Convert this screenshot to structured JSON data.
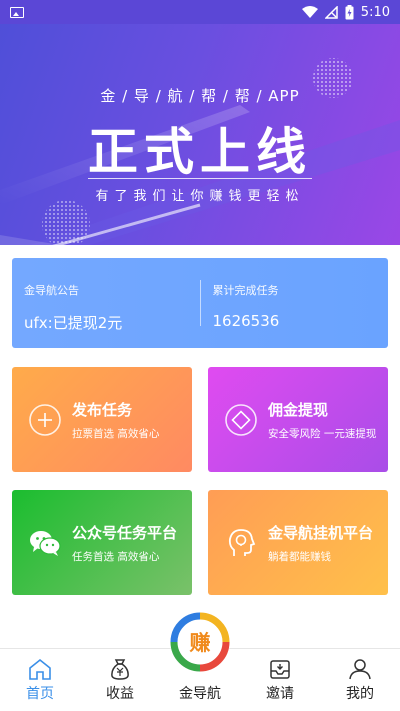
{
  "status_bar": {
    "time": "5:10",
    "icons": [
      "image-icon",
      "wifi-icon",
      "no-signal-icon",
      "battery-charging-icon"
    ]
  },
  "hero": {
    "tagline": "金 / 导 / 航 / 帮 / 帮 / APP",
    "title": "正式上线",
    "subtitle": "有了我们让你赚钱更轻松",
    "colors": {
      "start": "#4e4fd8",
      "end": "#9a47e6"
    }
  },
  "notice": {
    "left": {
      "label": "金导航公告",
      "value": "ufx:已提现2元"
    },
    "right": {
      "label": "累计完成任务",
      "value": "1626536"
    }
  },
  "cards": [
    {
      "title": "发布任务",
      "desc": "拉票首选 高效省心",
      "icon": "plus-circle-icon"
    },
    {
      "title": "佣金提现",
      "desc": "安全零风险 一元速提现",
      "icon": "diamond-icon"
    },
    {
      "title": "公众号任务平台",
      "desc": "任务首选 高效省心",
      "icon": "wechat-icon"
    },
    {
      "title": "金导航挂机平台",
      "desc": "躺着都能赚钱",
      "icon": "head-bulb-icon"
    }
  ],
  "center_logo": {
    "char": "赚"
  },
  "nav": [
    {
      "label": "首页",
      "icon": "home-icon",
      "active": true
    },
    {
      "label": "收益",
      "icon": "money-bag-icon"
    },
    {
      "label": "金导航",
      "icon": "logo-icon"
    },
    {
      "label": "邀请",
      "icon": "inbox-icon"
    },
    {
      "label": "我的",
      "icon": "person-icon"
    }
  ],
  "accent": "#3a8fe8"
}
